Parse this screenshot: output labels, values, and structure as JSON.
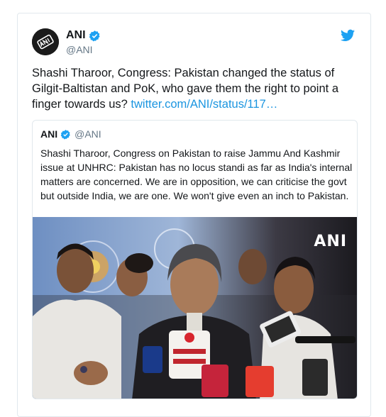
{
  "tweet": {
    "author_name": "ANI",
    "author_handle": "@ANI",
    "text": "Shashi Tharoor, Congress: Pakistan changed the status of Gilgit-Baltistan and PoK, who gave them the right to point a finger towards us? ",
    "link_text": "twitter.com/ANI/status/117…"
  },
  "quoted_tweet": {
    "author_name": "ANI",
    "author_handle": "@ANI",
    "text": "Shashi Tharoor, Congress on Pakistan to raise Jammu And Kashmir issue at UNHRC: Pakistan has no locus standi as far as India's internal matters are concerned. We are in opposition, we can criticise the govt but outside India, we are one. We won't give even an inch to Pakistan.",
    "media_watermark": "ANI"
  },
  "colors": {
    "link": "#1b95e0",
    "verified": "#1da1f2",
    "bird": "#1da1f2"
  },
  "icons": [
    "avatar",
    "verified-icon",
    "twitter-bird-icon"
  ]
}
